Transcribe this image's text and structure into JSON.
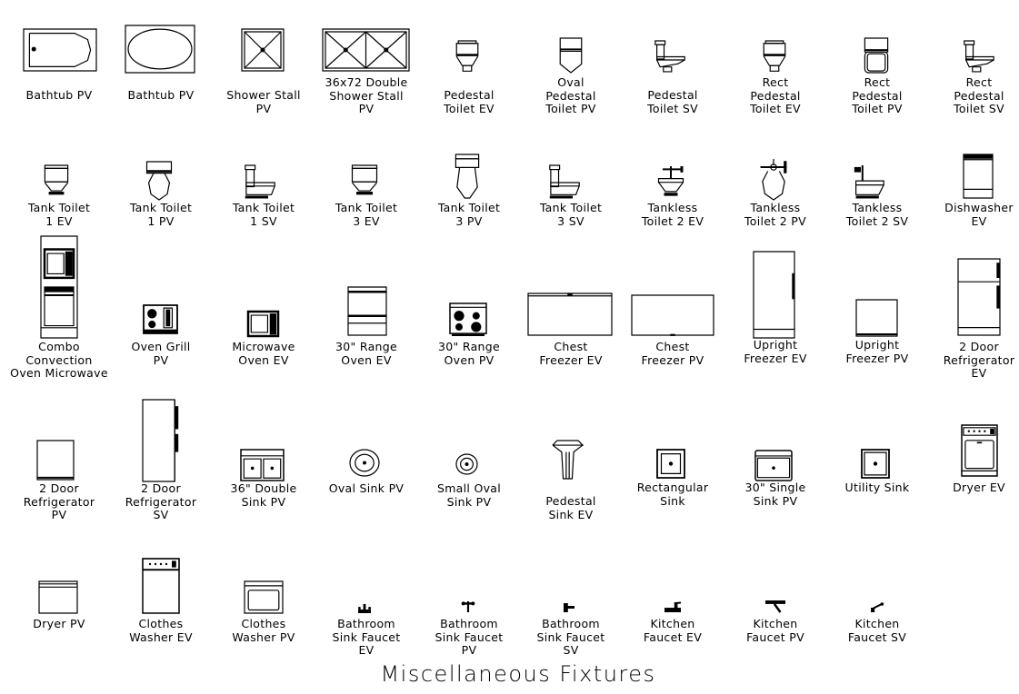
{
  "title": "Miscellaneous Fixtures",
  "fixtures": [
    {
      "id": "bathtub-pv-1",
      "label": "Bathtub PV"
    },
    {
      "id": "bathtub-pv-2",
      "label": "Bathtub PV"
    },
    {
      "id": "shower-stall-pv",
      "label": "Shower Stall\nPV"
    },
    {
      "id": "double-shower-stall-pv",
      "label": "36x72 Double\nShower Stall\nPV"
    },
    {
      "id": "pedestal-toilet-ev",
      "label": "Pedestal\nToilet EV"
    },
    {
      "id": "oval-pedestal-toilet-pv",
      "label": "Oval\nPedestal\nToilet PV"
    },
    {
      "id": "pedestal-toilet-sv",
      "label": "Pedestal\nToilet SV"
    },
    {
      "id": "rect-pedestal-toilet-ev",
      "label": "Rect\nPedestal\nToilet EV"
    },
    {
      "id": "rect-pedestal-toilet-pv",
      "label": "Rect\nPedestal\nToilet PV"
    },
    {
      "id": "rect-pedestal-toilet-sv",
      "label": "Rect\nPedestal\nToilet SV"
    },
    {
      "id": "tank-toilet-1-ev",
      "label": "Tank Toilet\n1 EV"
    },
    {
      "id": "tank-toilet-1-pv",
      "label": "Tank Toilet\n1 PV"
    },
    {
      "id": "tank-toilet-1-sv",
      "label": "Tank Toilet\n1 SV"
    },
    {
      "id": "tank-toilet-3-ev",
      "label": "Tank Toilet\n3 EV"
    },
    {
      "id": "tank-toilet-3-pv",
      "label": "Tank Toilet\n3 PV"
    },
    {
      "id": "tank-toilet-3-sv",
      "label": "Tank Toilet\n3 SV"
    },
    {
      "id": "tankless-toilet-2-ev",
      "label": "Tankless\nToilet 2 EV"
    },
    {
      "id": "tankless-toilet-2-pv",
      "label": "Tankless\nToilet 2 PV"
    },
    {
      "id": "tankless-toilet-2-sv",
      "label": "Tankless\nToilet 2 SV"
    },
    {
      "id": "dishwasher-ev",
      "label": "Dishwasher\nEV"
    },
    {
      "id": "combo-convection-oven-microwave",
      "label": "Combo\nConvection\nOven Microwave"
    },
    {
      "id": "oven-grill-pv",
      "label": "Oven Grill\nPV"
    },
    {
      "id": "microwave-oven-ev",
      "label": "Microwave\nOven EV"
    },
    {
      "id": "range-oven-ev",
      "label": "30\" Range\nOven EV"
    },
    {
      "id": "range-oven-pv",
      "label": "30\" Range\nOven PV"
    },
    {
      "id": "chest-freezer-ev",
      "label": "Chest\nFreezer EV"
    },
    {
      "id": "chest-freezer-pv",
      "label": "Chest\nFreezer PV"
    },
    {
      "id": "upright-freezer-ev",
      "label": "Upright\nFreezer EV"
    },
    {
      "id": "upright-freezer-pv",
      "label": "Upright\nFreezer PV"
    },
    {
      "id": "two-door-refrigerator-ev",
      "label": "2 Door\nRefrigerator\nEV"
    },
    {
      "id": "two-door-refrigerator-pv",
      "label": "2 Door\nRefrigerator\nPV"
    },
    {
      "id": "two-door-refrigerator-sv",
      "label": "2 Door\nRefrigerator\nSV"
    },
    {
      "id": "double-sink-pv",
      "label": "36\" Double\nSink PV"
    },
    {
      "id": "oval-sink-pv",
      "label": "Oval Sink PV"
    },
    {
      "id": "small-oval-sink-pv",
      "label": "Small Oval\nSink PV"
    },
    {
      "id": "pedestal-sink-ev",
      "label": "Pedestal\nSink EV"
    },
    {
      "id": "rectangular-sink",
      "label": "Rectangular\nSink"
    },
    {
      "id": "single-sink-pv",
      "label": "30\" Single\nSink PV"
    },
    {
      "id": "utility-sink",
      "label": "Utility Sink"
    },
    {
      "id": "dryer-ev",
      "label": "Dryer EV"
    },
    {
      "id": "dryer-pv",
      "label": "Dryer PV"
    },
    {
      "id": "clothes-washer-ev",
      "label": "Clothes\nWasher EV"
    },
    {
      "id": "clothes-washer-pv",
      "label": "Clothes\nWasher PV"
    },
    {
      "id": "bathroom-sink-faucet-ev",
      "label": "Bathroom\nSink Faucet\nEV"
    },
    {
      "id": "bathroom-sink-faucet-pv",
      "label": "Bathroom\nSink Faucet\nPV"
    },
    {
      "id": "bathroom-sink-faucet-sv",
      "label": "Bathroom\nSink Faucet\nSV"
    },
    {
      "id": "kitchen-faucet-ev",
      "label": "Kitchen\nFaucet EV"
    },
    {
      "id": "kitchen-faucet-pv",
      "label": "Kitchen\nFaucet PV"
    },
    {
      "id": "kitchen-faucet-sv",
      "label": "Kitchen\nFaucet SV"
    }
  ]
}
